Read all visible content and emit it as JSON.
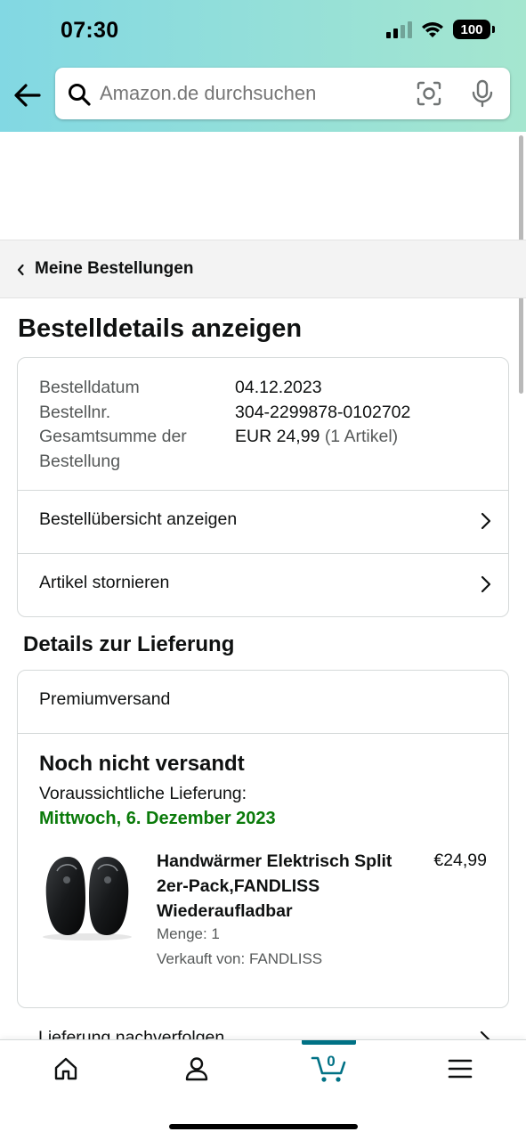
{
  "status_bar": {
    "time": "07:30",
    "battery": "100"
  },
  "search": {
    "placeholder": "Amazon.de durchsuchen"
  },
  "breadcrumb": {
    "label": "Meine Bestellungen"
  },
  "page_title": "Bestelldetails anzeigen",
  "order_summary": {
    "date_label": "Bestelldatum",
    "date_value": "04.12.2023",
    "number_label": "Bestellnr.",
    "number_value": "304-2299878-0102702",
    "total_label_line1": "Gesamtsumme der",
    "total_label_line2": "Bestellung",
    "total_value": "EUR 24,99",
    "total_items": "(1 Artikel)"
  },
  "actions": {
    "view_summary": "Bestellübersicht anzeigen",
    "cancel_items": "Artikel stornieren"
  },
  "delivery": {
    "section_title": "Details zur Lieferung",
    "shipping_type": "Premiumversand",
    "status": "Noch nicht versandt",
    "estimate_label": "Voraussichtliche Lieferung:",
    "estimate_date": "Mittwoch, 6. Dezember 2023",
    "estimate_color": "#0a7a0a",
    "product": {
      "title": "Handwärmer Elektrisch Split 2er-Pack,FANDLISS Wiederaufladbar",
      "price": "€24,99",
      "quantity": "Menge: 1",
      "seller": "Verkauft von: FANDLISS"
    },
    "track_label": "Lieferung nachverfolgen"
  },
  "bottom_nav": {
    "items": [
      "home-icon",
      "account-icon",
      "cart-icon",
      "menu-icon"
    ],
    "cart_count": "0",
    "active_color": "#007185"
  }
}
